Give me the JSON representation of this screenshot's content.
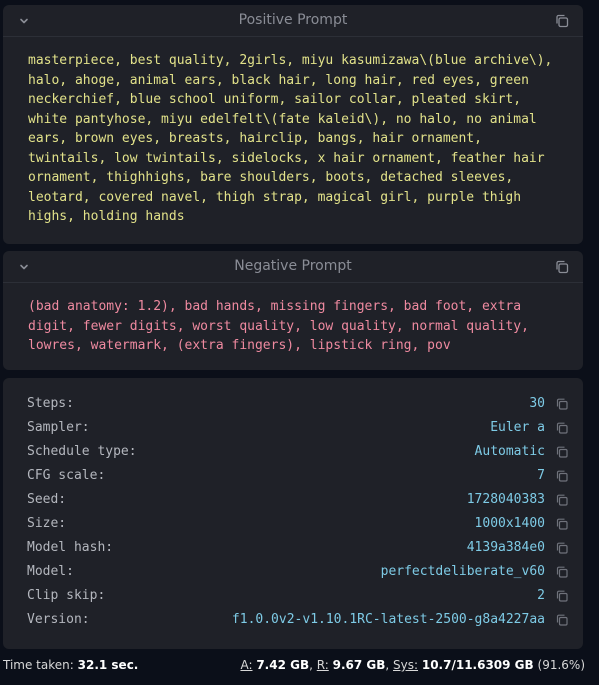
{
  "positive": {
    "title": "Positive Prompt",
    "text": "masterpiece, best quality, 2girls, miyu kasumizawa\\(blue archive\\), halo, ahoge, animal ears, black hair, long hair, red eyes, green neckerchief, blue school uniform, sailor collar, pleated skirt, white pantyhose, miyu edelfelt\\(fate kaleid\\), no halo, no animal ears, brown eyes, breasts, hairclip, bangs, hair ornament, twintails, low twintails, sidelocks, x hair ornament, feather hair ornament, thighhighs, bare shoulders, boots, detached sleeves, leotard, covered navel, thigh strap, magical girl, purple thigh highs, holding hands"
  },
  "negative": {
    "title": "Negative Prompt",
    "text": "(bad anatomy: 1.2), bad hands, missing fingers, bad foot, extra digit, fewer digits, worst quality, low quality, normal quality, lowres, watermark, (extra fingers), lipstick ring, pov"
  },
  "params": [
    {
      "label": "Steps:",
      "value": "30"
    },
    {
      "label": "Sampler:",
      "value": "Euler a"
    },
    {
      "label": "Schedule type:",
      "value": "Automatic"
    },
    {
      "label": "CFG scale:",
      "value": "7"
    },
    {
      "label": "Seed:",
      "value": "1728040383"
    },
    {
      "label": "Size:",
      "value": "1000x1400"
    },
    {
      "label": "Model hash:",
      "value": "4139a384e0"
    },
    {
      "label": "Model:",
      "value": "perfectdeliberate_v60"
    },
    {
      "label": "Clip skip:",
      "value": "2"
    },
    {
      "label": "Version:",
      "value": "f1.0.0v2-v1.10.1RC-latest-2500-g8a4227aa"
    }
  ],
  "footer": {
    "time_label": "Time taken:",
    "time_value": "32.1 sec.",
    "a_label": "A:",
    "a_value": "7.42 GB",
    "r_label": "R:",
    "r_value": "9.67 GB",
    "sys_label": "Sys:",
    "sys_value": "10.7/11.6309 GB",
    "sys_percent": "(91.6%)"
  },
  "colors": {
    "positive_text": "#e2e28a",
    "negative_text": "#ef8aa0",
    "param_value": "#7ecbe6"
  },
  "icons": [
    "chevron-down-icon",
    "copy-icon"
  ]
}
